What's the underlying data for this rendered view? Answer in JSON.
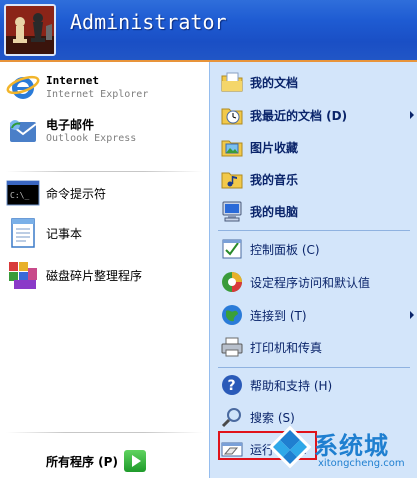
{
  "user": {
    "name": "Administrator"
  },
  "pinned": [
    {
      "title": "Internet",
      "subtitle": "Internet Explorer",
      "icon": "internet-explorer-icon"
    },
    {
      "title": "电子邮件",
      "subtitle": "Outlook Express",
      "icon": "outlook-express-icon"
    }
  ],
  "recent": [
    {
      "label": "命令提示符",
      "icon": "command-prompt-icon"
    },
    {
      "label": "记事本",
      "icon": "notepad-icon"
    },
    {
      "label": "磁盘碎片整理程序",
      "icon": "defragmenter-icon"
    }
  ],
  "all_programs": {
    "label": "所有程序 (P)"
  },
  "places": [
    {
      "label": "我的文档",
      "icon": "my-documents-icon",
      "bold": true,
      "submenu": false
    },
    {
      "label": "我最近的文档 (D)",
      "icon": "recent-documents-icon",
      "bold": true,
      "submenu": true
    },
    {
      "label": "图片收藏",
      "icon": "my-pictures-icon",
      "bold": true,
      "submenu": false
    },
    {
      "label": "我的音乐",
      "icon": "my-music-icon",
      "bold": true,
      "submenu": false
    },
    {
      "label": "我的电脑",
      "icon": "my-computer-icon",
      "bold": true,
      "submenu": false
    }
  ],
  "settings": [
    {
      "label": "控制面板 (C)",
      "icon": "control-panel-icon",
      "submenu": false
    },
    {
      "label": "设定程序访问和默认值",
      "icon": "program-access-icon",
      "submenu": false
    },
    {
      "label": "连接到 (T)",
      "icon": "connect-to-icon",
      "submenu": true
    },
    {
      "label": "打印机和传真",
      "icon": "printer-icon",
      "submenu": false
    }
  ],
  "tools": [
    {
      "label": "帮助和支持 (H)",
      "icon": "help-icon"
    },
    {
      "label": "搜索 (S)",
      "icon": "search-icon"
    },
    {
      "label": "运行 (R)...",
      "icon": "run-icon"
    }
  ],
  "watermark": {
    "brand": "系统城",
    "url": "xitongcheng.com"
  },
  "colors": {
    "header_blue": "#1e5bd2",
    "right_panel": "#d3e5fa",
    "highlight_red": "#e0131b",
    "watermark_blue": "#1f7fd0"
  }
}
